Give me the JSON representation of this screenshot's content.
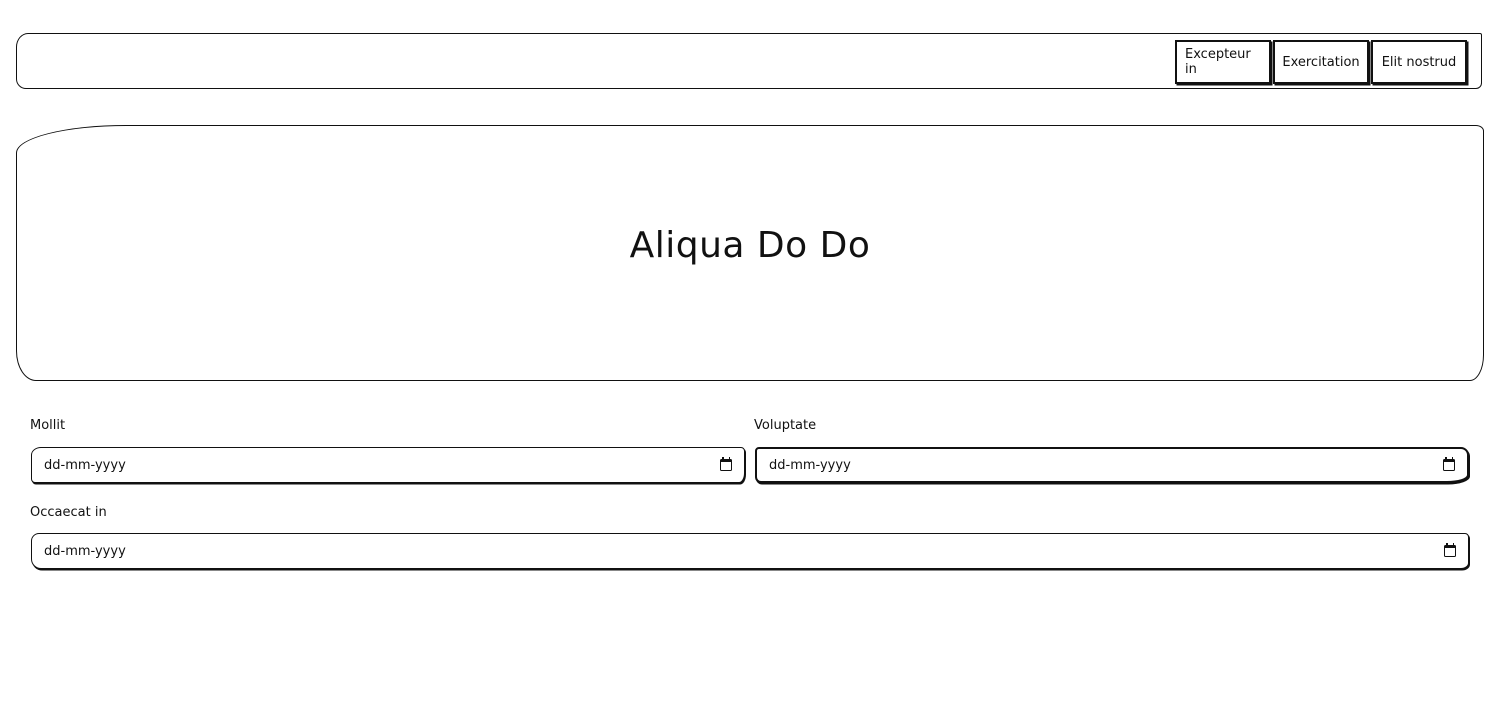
{
  "navbar": {
    "buttons": [
      "Excepteur in",
      "Exercitation",
      "Elit nostrud"
    ]
  },
  "hero": {
    "title": "Aliqua Do Do"
  },
  "form": {
    "fields": [
      {
        "label": "Mollit",
        "value": "dd-mm-yyyy",
        "icon": "calendar-icon"
      },
      {
        "label": "Voluptate",
        "value": "dd-mm-yyyy",
        "icon": "calendar-icon"
      },
      {
        "label": "Occaecat in",
        "value": "dd-mm-yyyy",
        "icon": "calendar-icon"
      }
    ]
  }
}
